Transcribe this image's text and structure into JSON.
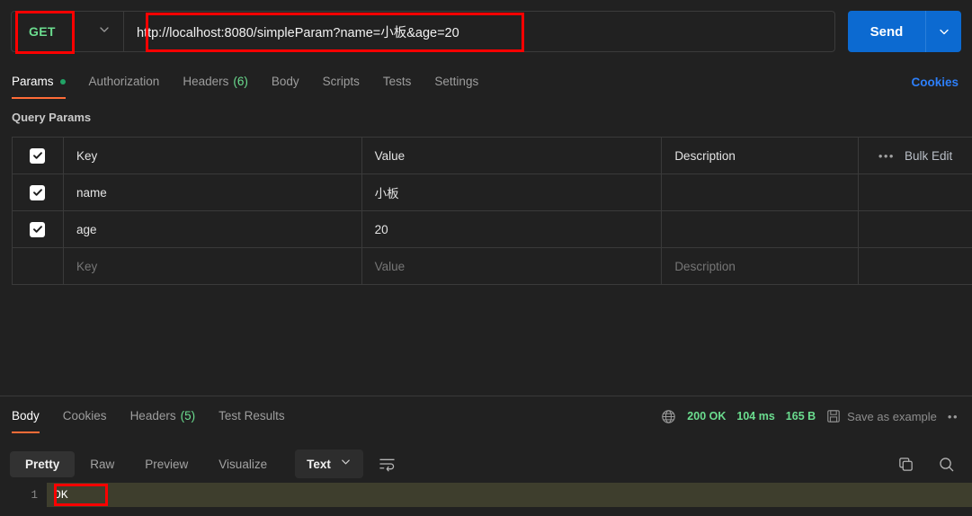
{
  "request": {
    "method": "GET",
    "url": "http://localhost:8080/simpleParam?name=小板&age=20",
    "send_label": "Send",
    "method_chevron_icon": "chevron-down-icon",
    "send_chevron_icon": "chevron-down-icon"
  },
  "request_tabs": [
    {
      "label": "Params",
      "active": true,
      "has_dot": true
    },
    {
      "label": "Authorization",
      "active": false
    },
    {
      "label": "Headers",
      "count": "(6)",
      "active": false
    },
    {
      "label": "Body",
      "active": false
    },
    {
      "label": "Scripts",
      "active": false
    },
    {
      "label": "Tests",
      "active": false
    },
    {
      "label": "Settings",
      "active": false
    }
  ],
  "cookies_link": "Cookies",
  "query_params": {
    "section_title": "Query Params",
    "columns": [
      "Key",
      "Value",
      "Description"
    ],
    "bulk_edit_label": "Bulk Edit",
    "more_icon": "ellipsis-icon",
    "rows": [
      {
        "checked": true,
        "key": "name",
        "value": "小板",
        "description": ""
      },
      {
        "checked": true,
        "key": "age",
        "value": "20",
        "description": ""
      }
    ],
    "empty_row": {
      "key": "Key",
      "value": "Value",
      "description": "Description"
    }
  },
  "response_tabs": [
    {
      "label": "Body",
      "active": true
    },
    {
      "label": "Cookies",
      "active": false
    },
    {
      "label": "Headers",
      "count": "(5)",
      "active": false
    },
    {
      "label": "Test Results",
      "active": false
    }
  ],
  "response_status": {
    "globe_icon": "globe-icon",
    "status": "200 OK",
    "time": "104 ms",
    "size": "165 B",
    "save_icon": "save-icon",
    "save_label": "Save as example",
    "more_icon": "ellipsis-icon"
  },
  "body_toolbar": {
    "views": [
      {
        "label": "Pretty",
        "active": true
      },
      {
        "label": "Raw",
        "active": false
      },
      {
        "label": "Preview",
        "active": false
      },
      {
        "label": "Visualize",
        "active": false
      }
    ],
    "format": "Text",
    "format_chevron_icon": "chevron-down-icon",
    "wrap_icon": "text-wrap-icon",
    "copy_icon": "copy-icon",
    "search_icon": "search-icon"
  },
  "response_body": {
    "lines": [
      {
        "number": "1",
        "text": "OK"
      }
    ]
  },
  "colors": {
    "accent": "#ff6c37",
    "send": "#0c6ad1",
    "method_green": "#6bdd8f",
    "status_green": "#6bdd8f",
    "link_blue": "#2d7ff9",
    "annotation_red": "#ff0000",
    "background": "#212121",
    "highlight_row": "#3e3e2d"
  }
}
